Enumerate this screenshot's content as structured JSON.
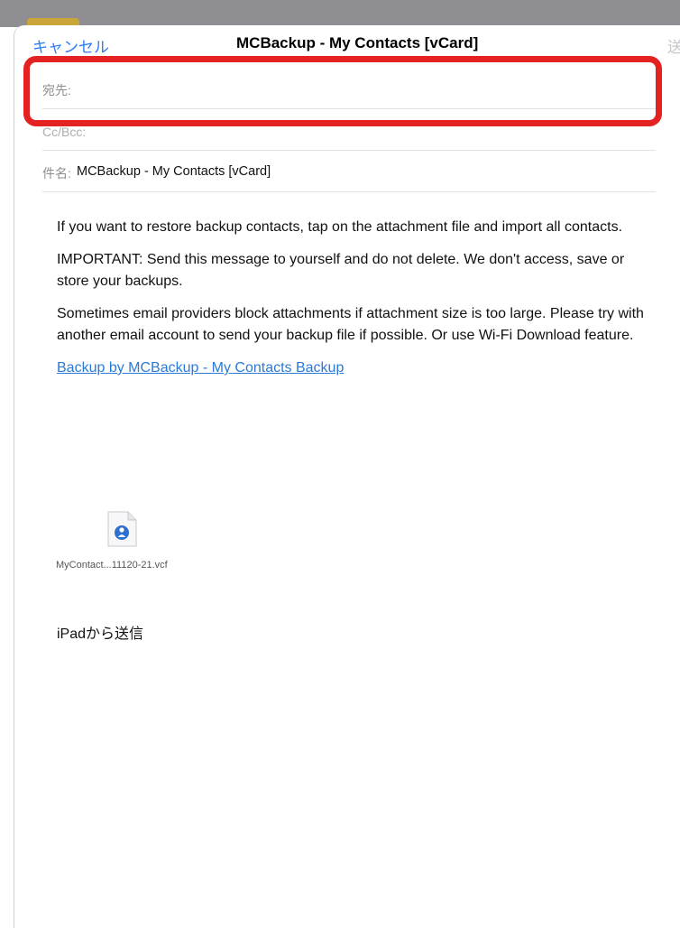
{
  "nav": {
    "cancel_label": "キャンセル",
    "title": "MCBackup - My Contacts [vCard]",
    "send_label": "送信"
  },
  "fields": {
    "to_label": "宛先:",
    "to_value": "",
    "cc_label": "Cc/Bcc:",
    "subject_label": "件名:",
    "subject_value": "MCBackup - My Contacts [vCard]"
  },
  "body": {
    "paragraphs": [
      "If you want to restore backup contacts, tap on the attachment file and import all contacts.",
      "IMPORTANT: Send this message to yourself and do not delete. We don't access, save or store your backups.",
      "Sometimes email providers block attachments if attachment size is too large. Please try with another email account to send your backup file if possible. Or use Wi-Fi Download feature."
    ],
    "link_text": "Backup by MCBackup - My Contacts Backup"
  },
  "attachment": {
    "icon": "vcf-contact-file-icon",
    "filename": "MyContact...11120-21.vcf"
  },
  "signature": "iPadから送信",
  "colors": {
    "accent_blue": "#2f7bf0",
    "highlight_red": "#e52222",
    "send_disabled": "#c7c7cc",
    "status_bar": "#8e8e93"
  }
}
